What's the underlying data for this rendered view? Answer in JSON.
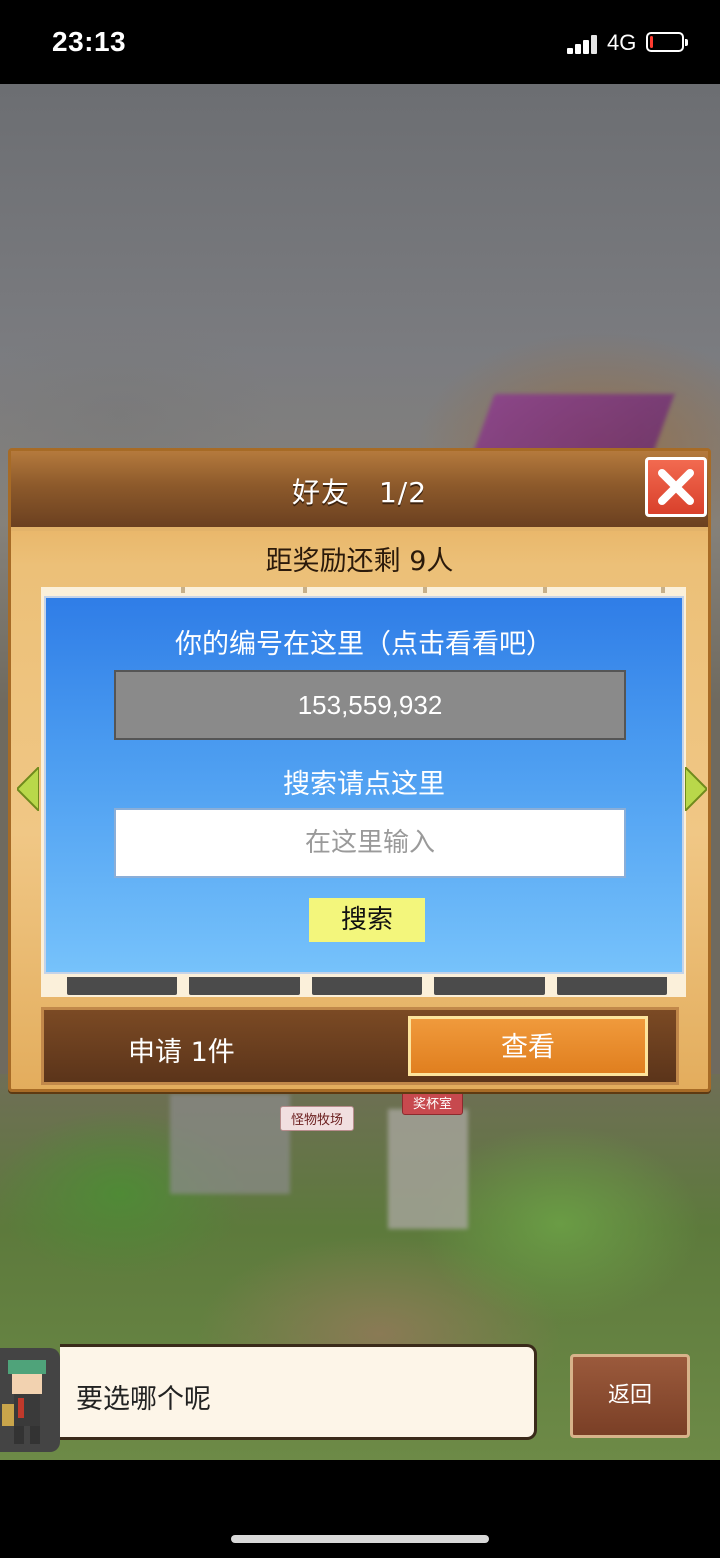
{
  "status_bar": {
    "time": "23:13",
    "network": "4G",
    "battery_level": 0.1,
    "battery_color": "#ff3b30"
  },
  "scene": {
    "signs": [
      "怪物牧场",
      "奖杯室"
    ]
  },
  "dialog": {
    "title": "好友　1/2",
    "close_icon": "close-x-icon",
    "reward_text": "距奖励还剩 9人",
    "id_label": "你的编号在这里（点击看看吧）",
    "id_value": "153,559,932",
    "search_label": "搜索请点这里",
    "search_placeholder": "在这里输入",
    "search_value": "",
    "search_button": "搜索",
    "requests_text": "申请 1件",
    "view_button": "查看",
    "nav_icons": [
      "left-arrow-icon",
      "right-arrow-icon"
    ]
  },
  "npc": {
    "speech": "要选哪个呢",
    "back_button": "返回"
  },
  "colors": {
    "panel_blue": "#4a9bf0",
    "search_button_bg": "#f3f67c",
    "view_button_bg": "#e8892a",
    "close_button_bg": "#e4523a"
  }
}
